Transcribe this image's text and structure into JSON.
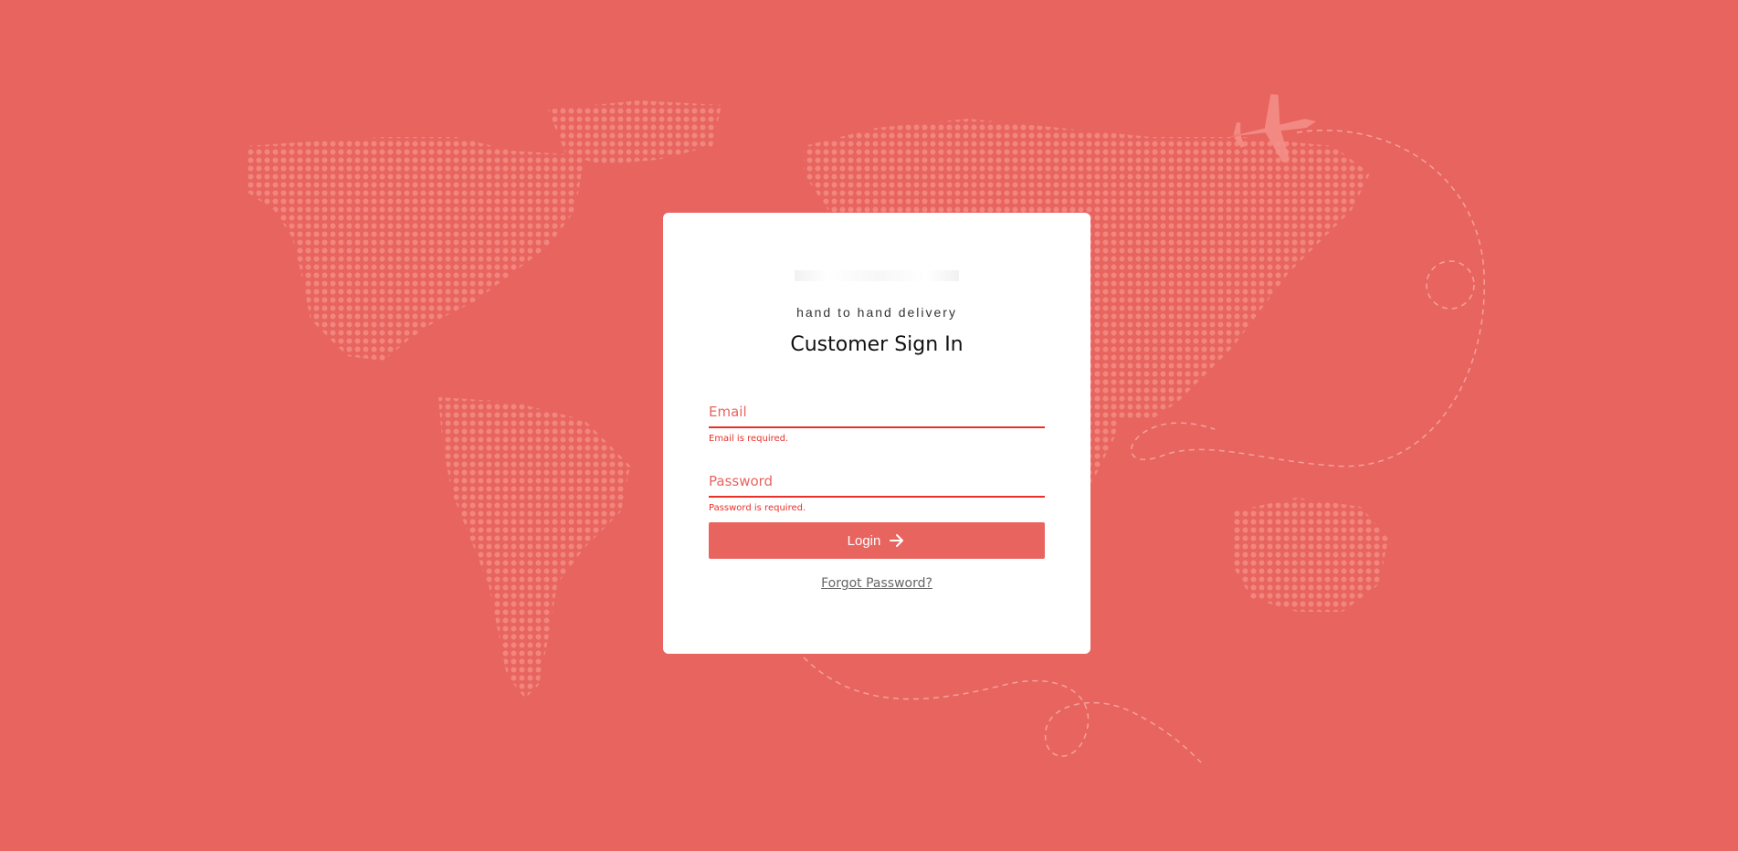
{
  "brand": {
    "tagline": "hand to hand delivery"
  },
  "form": {
    "title": "Customer Sign In",
    "email": {
      "placeholder": "Email",
      "value": "",
      "error": "Email is required."
    },
    "password": {
      "placeholder": "Password",
      "value": "",
      "error": "Password is required."
    },
    "login_label": "Login",
    "forgot_label": "Forgot Password?"
  },
  "colors": {
    "background": "#e8645f",
    "accent": "#e8645f",
    "error": "#e8302a",
    "card": "#ffffff"
  },
  "icons": {
    "login": "arrow-right-icon",
    "background": "world-map-dots",
    "airplane": "airplane-icon"
  }
}
